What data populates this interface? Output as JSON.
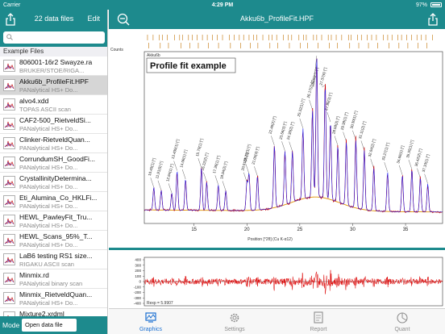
{
  "status": {
    "carrier": "Carrier",
    "time": "4:29 PM",
    "battery": "97%"
  },
  "sidebar": {
    "count_label": "22 data files",
    "edit_label": "Edit",
    "section": "Example Files",
    "files": [
      {
        "name": "806001-16r2 Swayze.ra",
        "sub": "BRUKER/STOE/RIGA..."
      },
      {
        "name": "Akku6b_ProfileFit.HPF",
        "sub": "PANalytical HS+ Do..."
      },
      {
        "name": "alvo4.xdd",
        "sub": "TOPAS ASCII scan"
      },
      {
        "name": "CAF2-500_RietveldSi...",
        "sub": "PANalytical HS+ Do..."
      },
      {
        "name": "Clinker-RietveldQuan...",
        "sub": "PANalytical HS+ Do..."
      },
      {
        "name": "CorrundumSH_GoodFi...",
        "sub": "PANalytical HS+ Do..."
      },
      {
        "name": "CrystallinityDetermina...",
        "sub": "PANalytical HS+ Do..."
      },
      {
        "name": "Eti_Alumina_Co_HKLFi...",
        "sub": "PANalytical HS+ Do..."
      },
      {
        "name": "HEWL_PawleyFit_Tru...",
        "sub": "PANalytical HS+ Do..."
      },
      {
        "name": "HEWL_Scans_95%_T...",
        "sub": "PANalytical HS+ Do..."
      },
      {
        "name": "LaB6 testing RS1 size...",
        "sub": "RIGAKU ASCII scan"
      },
      {
        "name": "Minmix.rd",
        "sub": "PANalytical binary scan"
      },
      {
        "name": "Minmix_RietveldQuan...",
        "sub": "PANalytical HS+ Do..."
      },
      {
        "name": "Mixture2.xrdml",
        "sub": ""
      }
    ],
    "selected_index": 1,
    "mode_label": "Mode",
    "mode_button": "Open data file"
  },
  "main": {
    "title": "Akku6b_ProfileFit.HPF"
  },
  "chart": {
    "counts_label": "Counts",
    "sample_label": "Akku6b",
    "title": "Profile fit example",
    "xlabel": "Position [°2θ] (Cu K-α12)",
    "residual_label": "Rexp = 5.9907",
    "colors": {
      "observed": "#cc0000",
      "calculated": "#2222ee",
      "background": "#e09000",
      "residual": "#dd0000",
      "ticks": "#c07000"
    }
  },
  "chart_data": {
    "type": "line",
    "title": "Profile fit example",
    "xlabel": "Position [°2θ] (Cu K-α12)",
    "ylabel": "Counts",
    "xlim": [
      10.3,
      38.5
    ],
    "x_ticks": [
      15,
      20,
      25,
      30,
      35
    ],
    "residual_ticks": [
      400,
      300,
      200,
      100,
      0,
      -100,
      -200,
      -300,
      -400
    ],
    "residual_ylim": [
      -400,
      400
    ],
    "peaks": [
      {
        "x": 11.2,
        "h": 0.16,
        "label": "10.40(1) [°]"
      },
      {
        "x": 11.9,
        "h": 0.14,
        "label": "11.91(9) [°]"
      },
      {
        "x": 12.9,
        "h": 0.12,
        "label": "12.94(1) [°]"
      },
      {
        "x": 13.4,
        "h": 0.28,
        "label": "13.405(1) [°]"
      },
      {
        "x": 14.2,
        "h": 0.22,
        "label": "14.06(1) [°]"
      },
      {
        "x": 15.7,
        "h": 0.3,
        "label": "15.70(1) [°]"
      },
      {
        "x": 16.2,
        "h": 0.2,
        "label": "16.22(2) [°]"
      },
      {
        "x": 17.3,
        "h": 0.18,
        "label": "17.36(1) [°]"
      },
      {
        "x": 18.0,
        "h": 0.14,
        "label": "18.04(2) [°]"
      },
      {
        "x": 20.0,
        "h": 0.2,
        "label": "20.01(2) [°]"
      },
      {
        "x": 20.2,
        "h": 0.26,
        "label": "20.22(3) [°]"
      },
      {
        "x": 21.0,
        "h": 0.24,
        "label": "21.03(3) [°]"
      },
      {
        "x": 22.6,
        "h": 0.44,
        "label": "22.46(2) [°]"
      },
      {
        "x": 23.6,
        "h": 0.38,
        "label": "23.56(3) [°]"
      },
      {
        "x": 24.3,
        "h": 0.36,
        "label": "24.30(2) [°]"
      },
      {
        "x": 25.3,
        "h": 0.5,
        "label": "25.32(1) [°]"
      },
      {
        "x": 26.2,
        "h": 0.62,
        "label": "26.17(2) [°]"
      },
      {
        "x": 26.6,
        "h": 1.0,
        "label": "26.60(1) [°]"
      },
      {
        "x": 27.4,
        "h": 0.8,
        "label": "27.37(6) [°]"
      },
      {
        "x": 27.9,
        "h": 0.55,
        "label": "27.89(3) [°]"
      },
      {
        "x": 28.6,
        "h": 0.4,
        "label": "28.58(2) [°]"
      },
      {
        "x": 29.4,
        "h": 0.45,
        "label": "29.38(1) [°]"
      },
      {
        "x": 30.3,
        "h": 0.48,
        "label": "30.30(1) [°]"
      },
      {
        "x": 31.1,
        "h": 0.42,
        "label": "31.11(2) [°]"
      },
      {
        "x": 32.0,
        "h": 0.3,
        "label": "32.04(2) [°]"
      },
      {
        "x": 33.3,
        "h": 0.28,
        "label": "33.27(1) [°]"
      },
      {
        "x": 34.7,
        "h": 0.26,
        "label": "34.66(1) [°]"
      },
      {
        "x": 35.6,
        "h": 0.3,
        "label": "35.55(1) [°]"
      },
      {
        "x": 36.4,
        "h": 0.24,
        "label": "36.42(2) [°]"
      },
      {
        "x": 37.1,
        "h": 0.2,
        "label": "37.10(1) [°]"
      }
    ]
  },
  "tabs": [
    {
      "label": "Graphics",
      "icon": "graphics-icon",
      "active": true
    },
    {
      "label": "Settings",
      "icon": "gear-icon",
      "active": false
    },
    {
      "label": "Report",
      "icon": "report-icon",
      "active": false
    },
    {
      "label": "Quant",
      "icon": "pie-icon",
      "active": false
    }
  ]
}
